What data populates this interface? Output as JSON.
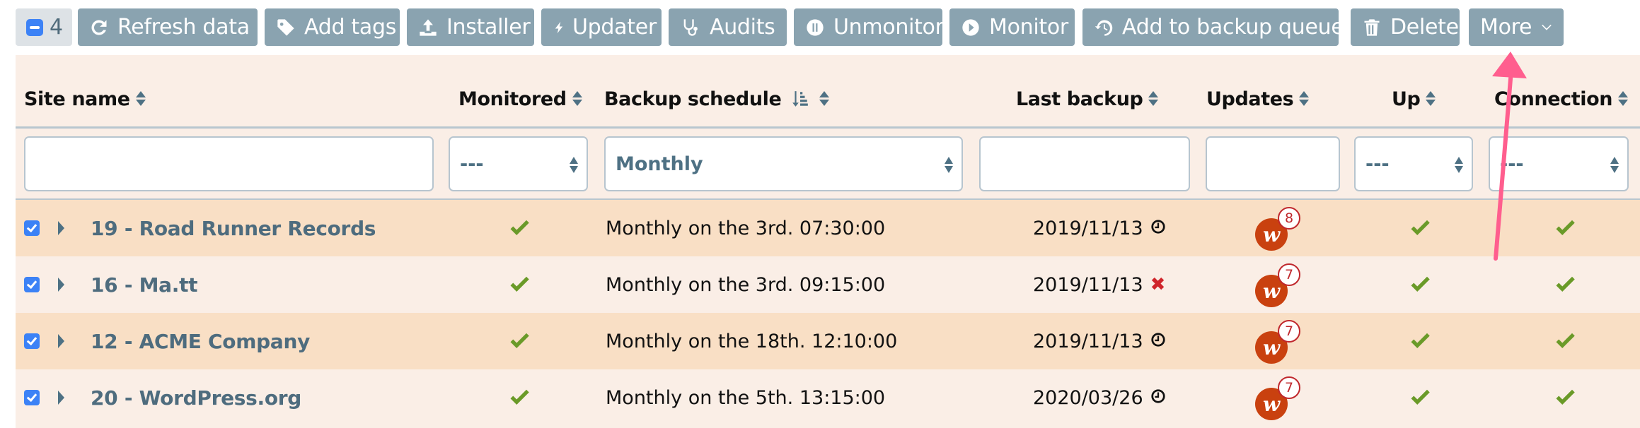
{
  "toolbar": {
    "selected_count": "4",
    "buttons": [
      {
        "label": "Refresh data",
        "icon": "refresh-icon"
      },
      {
        "label": "Add tags",
        "icon": "tag-icon"
      },
      {
        "label": "Installer",
        "icon": "upload-icon"
      },
      {
        "label": "Updater",
        "icon": "bolt-icon"
      },
      {
        "label": "Audits",
        "icon": "stethoscope-icon"
      },
      {
        "label": "Unmonitor",
        "icon": "pause-circle-icon"
      },
      {
        "label": "Monitor",
        "icon": "play-circle-icon"
      },
      {
        "label": "Add to backup queue",
        "icon": "history-icon"
      },
      {
        "label": "Delete",
        "icon": "trash-icon"
      },
      {
        "label": "More",
        "icon": "chevron-down-icon"
      }
    ]
  },
  "table": {
    "columns": [
      {
        "label": "Site name"
      },
      {
        "label": "Monitored"
      },
      {
        "label": "Backup schedule"
      },
      {
        "label": "Last backup"
      },
      {
        "label": "Updates"
      },
      {
        "label": "Up"
      },
      {
        "label": "Connection"
      }
    ],
    "filters": {
      "site_name": "",
      "monitored": "---",
      "backup_schedule": "Monthly",
      "last_backup": "",
      "updates": "",
      "up": "---",
      "connection": "---"
    },
    "rows": [
      {
        "selected": true,
        "site": "19 - Road Runner Records",
        "monitored": true,
        "schedule": "Monthly on the 3rd. 07:30:00",
        "last_backup": "2019/11/13",
        "backup_status": "scheduled",
        "updates": "8",
        "up": true,
        "connection": true
      },
      {
        "selected": true,
        "site": "16 - Ma.tt",
        "monitored": true,
        "schedule": "Monthly on the 3rd. 09:15:00",
        "last_backup": "2019/11/13",
        "backup_status": "failed",
        "updates": "7",
        "up": true,
        "connection": true
      },
      {
        "selected": true,
        "site": "12 - ACME Company",
        "monitored": true,
        "schedule": "Monthly on the 18th. 12:10:00",
        "last_backup": "2019/11/13",
        "backup_status": "scheduled",
        "updates": "7",
        "up": true,
        "connection": true
      },
      {
        "selected": true,
        "site": "20 - WordPress.org",
        "monitored": true,
        "schedule": "Monthly on the 5th. 13:15:00",
        "last_backup": "2020/03/26",
        "backup_status": "scheduled",
        "updates": "7",
        "up": true,
        "connection": true
      }
    ]
  },
  "colors": {
    "button_bg": "#8aa3b0",
    "accent_blue": "#3c82f6",
    "check_green": "#6a9a28",
    "error_red": "#d0252b",
    "annotation_arrow": "#ff5e8e"
  }
}
